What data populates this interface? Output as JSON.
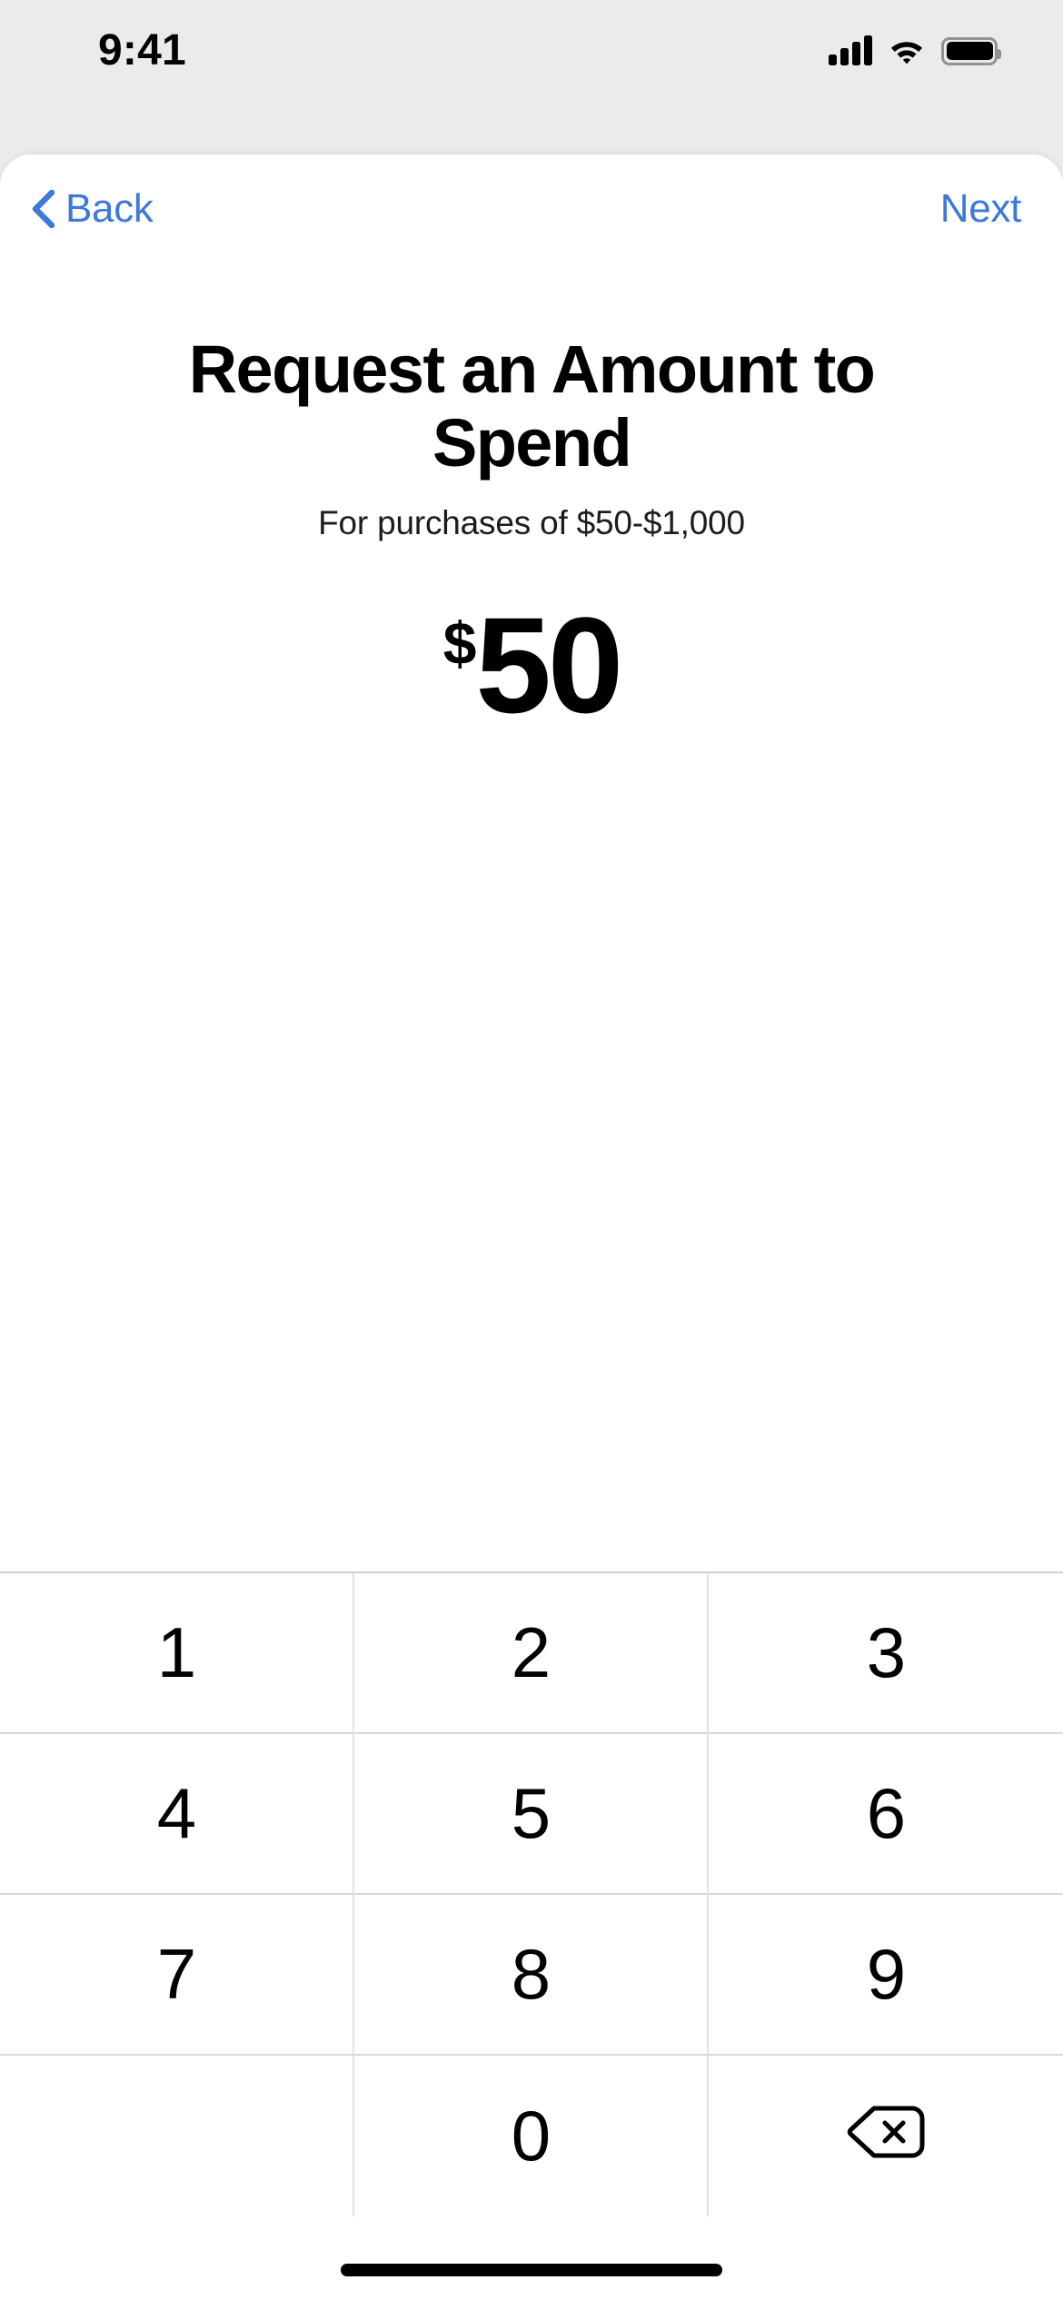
{
  "status_bar": {
    "time": "9:41",
    "icons": [
      "cellular-signal-icon",
      "wifi-icon",
      "battery-icon"
    ],
    "battery_full": true
  },
  "nav": {
    "back_label": "Back",
    "back_icon": "chevron-left-icon",
    "next_label": "Next",
    "accent_color": "#3c79d8"
  },
  "content": {
    "headline": "Request an Amount to Spend",
    "subtitle": "For purchases of $50-$1,000",
    "amount": {
      "currency_symbol": "$",
      "value": "50"
    }
  },
  "keypad": {
    "keys": [
      {
        "label": "1",
        "name": "key-1"
      },
      {
        "label": "2",
        "name": "key-2"
      },
      {
        "label": "3",
        "name": "key-3"
      },
      {
        "label": "4",
        "name": "key-4"
      },
      {
        "label": "5",
        "name": "key-5"
      },
      {
        "label": "6",
        "name": "key-6"
      },
      {
        "label": "7",
        "name": "key-7"
      },
      {
        "label": "8",
        "name": "key-8"
      },
      {
        "label": "9",
        "name": "key-9"
      },
      {
        "label": "",
        "name": "key-blank"
      },
      {
        "label": "0",
        "name": "key-0"
      },
      {
        "label": "",
        "name": "key-delete",
        "icon": "backspace-delete-icon"
      }
    ]
  },
  "home_indicator": "home-indicator-bar"
}
